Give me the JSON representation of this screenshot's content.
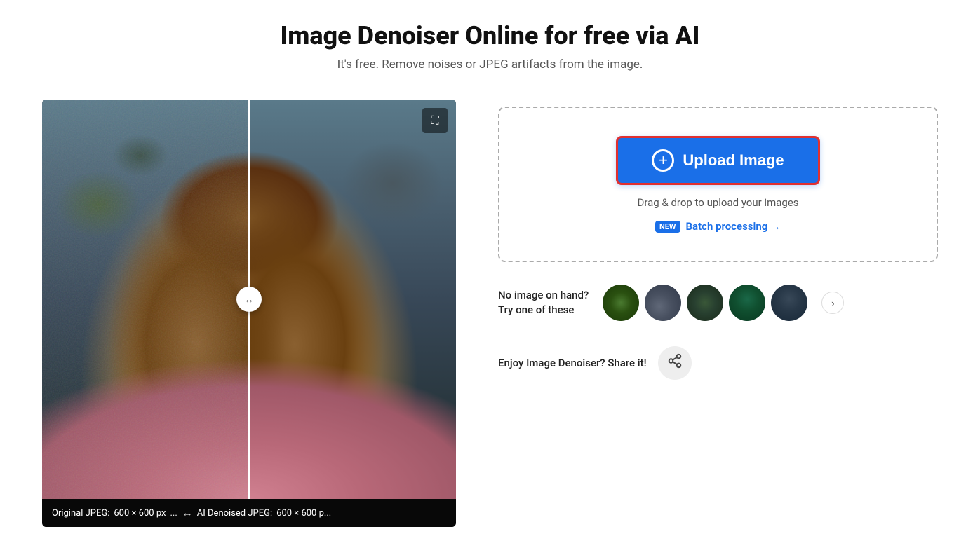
{
  "header": {
    "title": "Image Denoiser Online for free via AI",
    "subtitle": "It's free. Remove noises or JPEG artifacts from the image."
  },
  "image_panel": {
    "expand_icon": "⤢",
    "divider_arrows": "↔",
    "bottom_bar": {
      "left_label": "Original JPEG:",
      "left_size": "600 × 600 px",
      "ellipsis": "...",
      "right_label": "AI Denoised JPEG:",
      "right_size": "600 × 600 p..."
    }
  },
  "upload_box": {
    "upload_button_label": "Upload Image",
    "plus_icon": "+",
    "drag_drop_text": "Drag & drop to upload your images",
    "new_badge": "NEW",
    "batch_link_text": "Batch processing →"
  },
  "sample_section": {
    "label_line1": "No image on hand?",
    "label_line2": "Try one of these",
    "chevron": "›",
    "thumbnails": [
      {
        "id": 1,
        "alt": "sample-leaf"
      },
      {
        "id": 2,
        "alt": "sample-street"
      },
      {
        "id": 3,
        "alt": "sample-portrait"
      },
      {
        "id": 4,
        "alt": "sample-nature"
      },
      {
        "id": 5,
        "alt": "sample-dark"
      }
    ]
  },
  "share_section": {
    "label": "Enjoy Image Denoiser? Share it!",
    "share_icon": "⤢"
  }
}
